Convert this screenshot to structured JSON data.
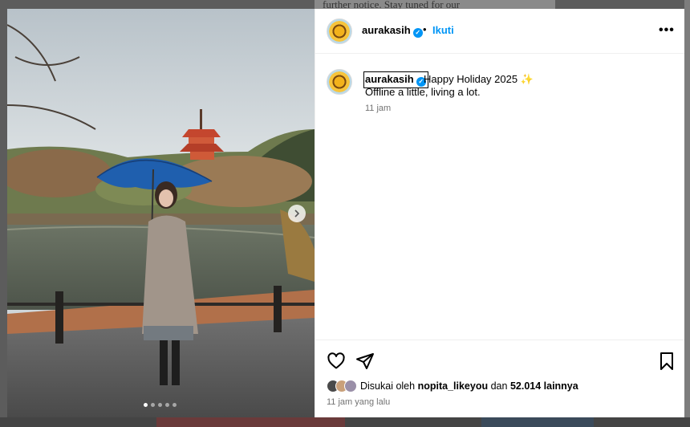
{
  "background": {
    "partial_text": "further notice. Stay tuned for our"
  },
  "post": {
    "header": {
      "username": "aurakasih",
      "separator": "•",
      "follow_label": "Ikuti",
      "more_label": "•••"
    },
    "caption": {
      "username": "aurakasih",
      "text": "Happy Holiday 2025 ✨",
      "line2": "Offline a little, living a lot.",
      "time": "11 jam"
    },
    "likes": {
      "prefix": "Disukai oleh",
      "user": "nopita_likeyou",
      "middle": "dan",
      "count": "52.014 lainnya"
    },
    "time_ago": "11 jam yang lalu",
    "carousel": {
      "total": 5,
      "active_index": 0
    }
  },
  "colors": {
    "accent": "#0095f6",
    "muted": "#737373",
    "border": "#efefef"
  },
  "icons": {
    "like": "heart-icon",
    "share": "send-icon",
    "save": "bookmark-icon",
    "more": "more-icon",
    "verified": "verified-badge-icon",
    "next": "chevron-right-icon"
  }
}
